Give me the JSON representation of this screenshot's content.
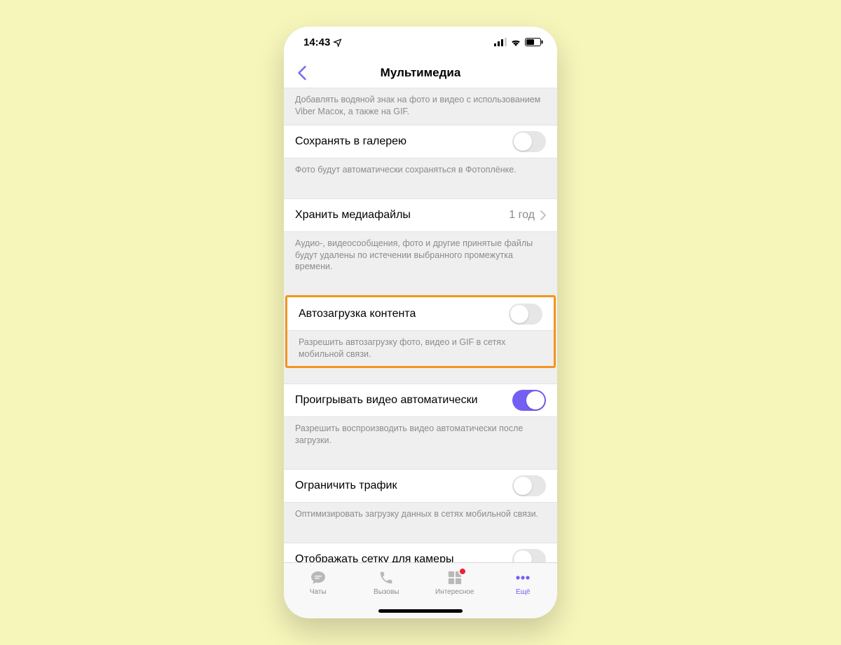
{
  "statusbar": {
    "time": "14:43"
  },
  "nav": {
    "title": "Мультимедиа"
  },
  "sections": {
    "watermark_desc": "Добавлять водяной знак на фото и видео с использованием Viber Масок, а также на GIF.",
    "save_gallery": {
      "label": "Сохранять в галерею",
      "desc": "Фото будут автоматически сохраняться в Фотоплёнке."
    },
    "store_media": {
      "label": "Хранить медиафайлы",
      "value": "1 год",
      "desc": "Аудио-, видеосообщения, фото и другие принятые файлы будут удалены по истечении выбранного промежутка времени."
    },
    "autoload": {
      "label": "Автозагрузка контента",
      "desc": "Разрешить автозагрузку фото, видео и GIF в сетях мобильной связи."
    },
    "autoplay": {
      "label": "Проигрывать видео автоматически",
      "desc": "Разрешить воспроизводить видео автоматически после загрузки."
    },
    "limit_traffic": {
      "label": "Ограничить трафик",
      "desc": "Оптимизировать загрузку данных в сетях мобильной связи."
    },
    "camera_grid": {
      "label": "Отображать сетку для камеры"
    }
  },
  "tabs": {
    "chats": "Чаты",
    "calls": "Вызовы",
    "explore": "Интересное",
    "more": "Ещё"
  }
}
